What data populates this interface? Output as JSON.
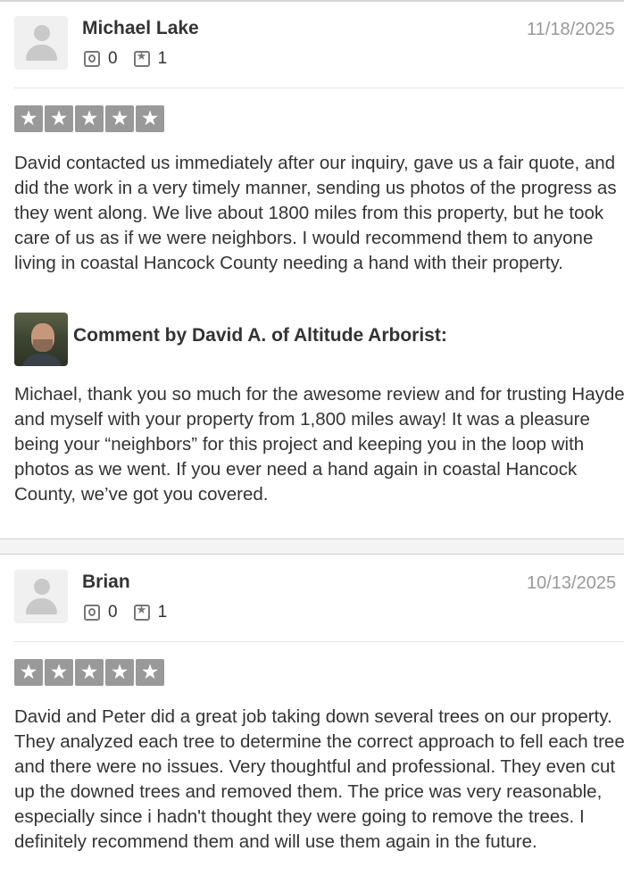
{
  "reviews": [
    {
      "name": "Michael Lake",
      "date": "11/18/2025",
      "friends_count": "0",
      "reviews_count": "1",
      "rating": 5,
      "text": "David contacted us immediately after our inquiry, gave us a fair quote, and did the work in a very timely manner, sending us photos of the progress as they went along. We live about 1800 miles from this property, but he took care of us as if we were neighbors. I would recommend them to anyone living in coastal Hancock County needing a hand with their property.",
      "comment": {
        "title": "Comment by David A. of Altitude Arborist:",
        "text": "Michael, thank you so much for the awesome review and for trusting Hayden and myself with your property from 1,800 miles away!  It was a pleasure being your “neighbors” for this project and keeping you in the loop with photos as we went. If you ever need a hand again in coastal Hancock County, we’ve got you covered."
      }
    },
    {
      "name": "Brian",
      "date": "10/13/2025",
      "friends_count": "0",
      "reviews_count": "1",
      "rating": 5,
      "text": "David and Peter did a great job taking down several trees on our property. They analyzed each tree to determine the correct approach to fell each tree, and there were no issues. Very thoughtful and professional. They even cut up the downed trees and removed them. The price was very reasonable, especially since i hadn't thought they were going to remove the trees. I definitely recommend them and will use them again in the future."
    }
  ]
}
